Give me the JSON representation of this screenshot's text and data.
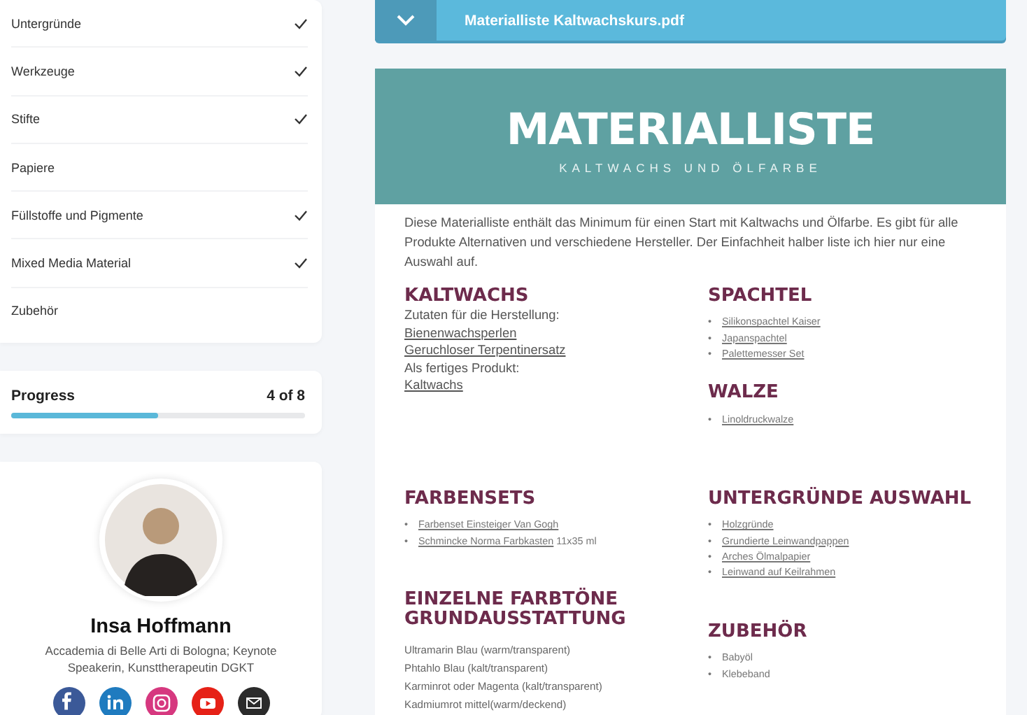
{
  "sidebar": {
    "lessons": [
      {
        "label": "Untergründe",
        "completed": true
      },
      {
        "label": "Werkzeuge",
        "completed": true
      },
      {
        "label": "Stifte",
        "completed": true
      },
      {
        "label": "Papiere",
        "completed": false
      },
      {
        "label": "Füllstoffe und Pigmente",
        "completed": true
      },
      {
        "label": "Mixed Media Material",
        "completed": true
      },
      {
        "label": "Zubehör",
        "completed": false
      }
    ],
    "progress": {
      "label": "Progress",
      "count": "4 of 8",
      "level": 0.5
    },
    "profile": {
      "name": "Insa Hoffmann",
      "bio": "Accademia di Belle Arti di Bologna; Keynote Speakerin, Kunsttherapeutin DGKT"
    }
  },
  "attachment": {
    "title": "Materialliste Kaltwachskurs.pdf"
  },
  "document": {
    "title": "MATERIALLISTE",
    "subtitle": "KALTWACHS UND ÖLFARBE",
    "intro": "Diese Materialliste enthält das Minimum für einen Start mit Kaltwachs und Ölfarbe. Es gibt für alle Produkte Alternativen und verschiedene Hersteller. Der Einfachheit halber liste ich hier nur eine Auswahl auf.",
    "rows": [
      [
        [
          {
            "title": "KALTWACHS",
            "kind": "lines",
            "items": [
              {
                "text": "Zutaten für die Herstellung:",
                "link": false
              },
              {
                "text": "Bienenwachsperlen",
                "link": true
              },
              {
                "text": "Geruchloser Terpentinersatz",
                "link": true
              },
              {
                "text": "Als fertiges Produkt:",
                "link": false
              },
              {
                "text": "Kaltwachs ",
                "link": true
              }
            ]
          }
        ],
        [
          {
            "title": "SPACHTEL",
            "kind": "bullets",
            "bullet": "•",
            "items": [
              {
                "text": "Silikonspachtel Kaiser",
                "link": true
              },
              {
                "text": "Japanspachtel ",
                "link": true
              },
              {
                "text": "Palettemesser Set",
                "link": true
              }
            ]
          },
          {
            "title": "WALZE",
            "kind": "bullets",
            "bullet": "•",
            "items": [
              {
                "text": "Linoldruckwalze",
                "link": true
              }
            ]
          }
        ]
      ],
      [
        [
          {
            "title": "FARBENSETS",
            "kind": "bullets",
            "bullet": "•",
            "items": [
              {
                "text": "Farbenset Einsteiger Van Gogh",
                "link": true
              },
              {
                "text": "Schmincke Norma Farbkasten",
                "link": true,
                "suffix": " 11x35 ml"
              }
            ]
          },
          {
            "title": "EINZELNE FARBTÖNE GRUNDAUSSTATTUNG",
            "kind": "small-lines",
            "items": [
              {
                "text": "Ultramarin Blau (warm/transparent)",
                "link": false
              },
              {
                "text": "Phtahlo Blau (kalt/transparent)",
                "link": false
              },
              {
                "text": "Karminrot oder Magenta (kalt/transparent)",
                "link": false
              },
              {
                "text": "Kadmiumrot  mittel(warm/deckend)",
                "link": false
              }
            ]
          }
        ],
        [
          {
            "title": "UNTERGRÜNDE AUSWAHL",
            "kind": "bullets",
            "bullet": "•",
            "items": [
              {
                "text": "Holzgründe",
                "link": true
              },
              {
                "text": "Grundierte Leinwandpappen",
                "link": true
              },
              {
                "text": "Arches Ölmalpapier",
                "link": true
              },
              {
                "text": "Leinwand auf Keilrahmen",
                "link": true
              }
            ]
          },
          {
            "title": "ZUBEHÖR",
            "kind": "bullets",
            "bullet": "•",
            "items": [
              {
                "text": "Babyöl",
                "link": false
              },
              {
                "text": "Klebeband",
                "link": false
              }
            ]
          }
        ]
      ]
    ]
  }
}
